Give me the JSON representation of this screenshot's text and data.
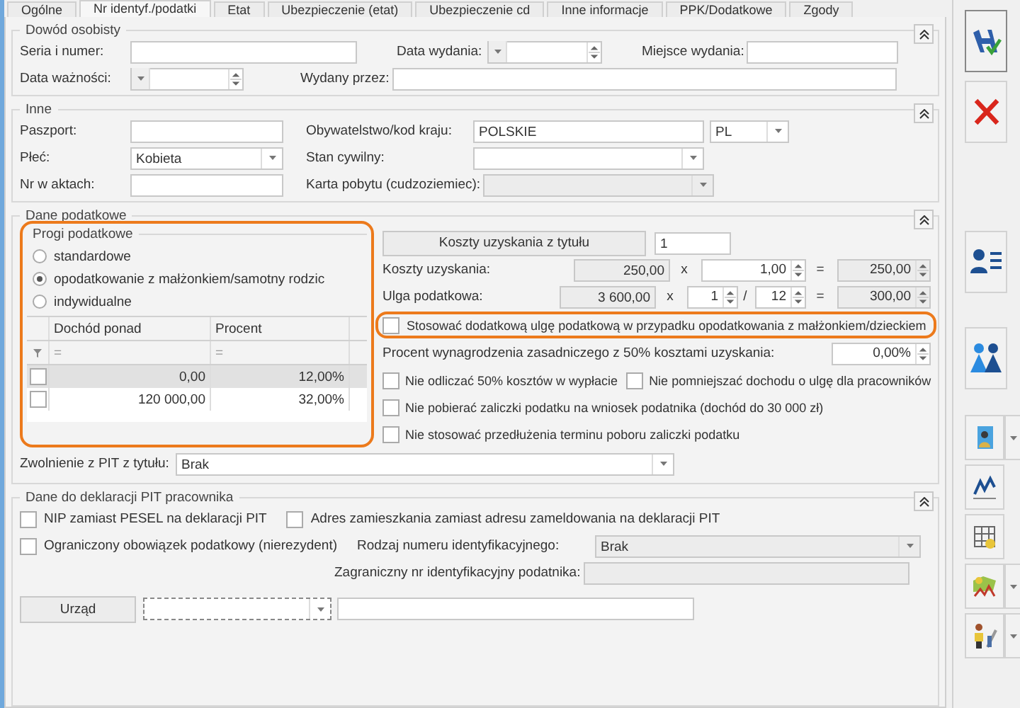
{
  "tabs": [
    {
      "label": "Ogólne",
      "selected": false
    },
    {
      "label": "Nr identyf./podatki",
      "selected": true
    },
    {
      "label": "Etat",
      "selected": false
    },
    {
      "label": "Ubezpieczenie (etat)",
      "selected": false
    },
    {
      "label": "Ubezpieczenie cd",
      "selected": false
    },
    {
      "label": "Inne informacje",
      "selected": false
    },
    {
      "label": "PPK/Dodatkowe",
      "selected": false
    },
    {
      "label": "Zgody",
      "selected": false
    }
  ],
  "dowod": {
    "title": "Dowód osobisty",
    "seria_label": "Seria i numer:",
    "data_wydania_label": "Data wydania:",
    "miejsce_wydania_label": "Miejsce wydania:",
    "data_waznosci_label": "Data ważności:",
    "wydany_przez_label": "Wydany przez:"
  },
  "inne": {
    "title": "Inne",
    "paszport_label": "Paszport:",
    "plec_label": "Płeć:",
    "plec_value": "Kobieta",
    "nr_akt_label": "Nr w aktach:",
    "obywatelstwo_label": "Obywatelstwo/kod kraju:",
    "obywatelstwo_value": "POLSKIE",
    "kod_kraju_value": "PL",
    "stan_label": "Stan cywilny:",
    "karta_label": "Karta pobytu (cudzoziemiec):",
    "karta_disabled": true
  },
  "podatkowe": {
    "title": "Dane podatkowe",
    "progi": {
      "title": "Progi podatkowe",
      "highlighted": true,
      "options": [
        {
          "label": "standardowe",
          "selected": false
        },
        {
          "label": "opodatkowanie z małżonkiem/samotny rodzic",
          "selected": true
        },
        {
          "label": "indywidualne",
          "selected": false
        }
      ],
      "columns": [
        "Dochód ponad",
        "Procent"
      ],
      "filter": [
        "=",
        "="
      ],
      "rows": [
        {
          "checked": false,
          "selected": true,
          "cells": [
            "0,00",
            "12,00%"
          ]
        },
        {
          "checked": false,
          "selected": false,
          "cells": [
            "120 000,00",
            "32,00%"
          ]
        }
      ]
    },
    "koszty_button": "Koszty uzyskania z tytułu",
    "koszty_tytul": "1",
    "koszty_label": "Koszty uzyskania:",
    "koszty_base": "250,00",
    "koszty_mult": "1,00",
    "koszty_result": "250,00",
    "koszty_ops": [
      "x",
      "="
    ],
    "ulga_label": "Ulga podatkowa:",
    "ulga_base": "3 600,00",
    "ulga_num": "1",
    "ulga_den": "12",
    "ulga_result": "300,00",
    "ulga_ops": [
      "x",
      "/",
      "="
    ],
    "extra_relief": {
      "label": "Stosować dodatkową ulgę podatkową w przypadku opodatkowania z małżonkiem/dzieckiem",
      "checked": false,
      "highlighted": true
    },
    "procent_label": "Procent wynagrodzenia zasadniczego z 50% kosztami uzyskania:",
    "procent_value": "0,00%",
    "option_rows": [
      [
        {
          "label": "Nie odliczać 50% kosztów w wypłacie",
          "checked": false
        },
        {
          "label": "Nie pomniejszać dochodu o ulgę dla pracowników",
          "checked": false
        }
      ],
      [
        {
          "label": "Nie pobierać zaliczki podatku na wniosek podatnika (dochód do 30 000 zł)",
          "checked": false
        }
      ],
      [
        {
          "label": "Nie stosować przedłużenia terminu poboru zaliczki podatku",
          "checked": false
        }
      ]
    ],
    "zwolnienie_label": "Zwolnienie z PIT z tytułu:",
    "zwolnienie_value": "Brak"
  },
  "pit": {
    "title": "Dane do deklaracji PIT pracownika",
    "checks_row": [
      {
        "label": "NIP zamiast PESEL na deklaracji PIT",
        "checked": false
      },
      {
        "label": "Adres zamieszkania zamiast adresu zameldowania na deklaracji PIT",
        "checked": false
      }
    ],
    "nierezydent": {
      "label": "Ograniczony obowiązek podatkowy (nierezydent)",
      "checked": false
    },
    "rodzaj_label": "Rodzaj numeru identyfikacyjnego:",
    "rodzaj_value": "Brak",
    "rodzaj_disabled": true,
    "zagraniczny_label": "Zagraniczny nr identyfikacyjny podatnika:",
    "zagraniczny_disabled": true,
    "urzad_button": "Urząd"
  }
}
